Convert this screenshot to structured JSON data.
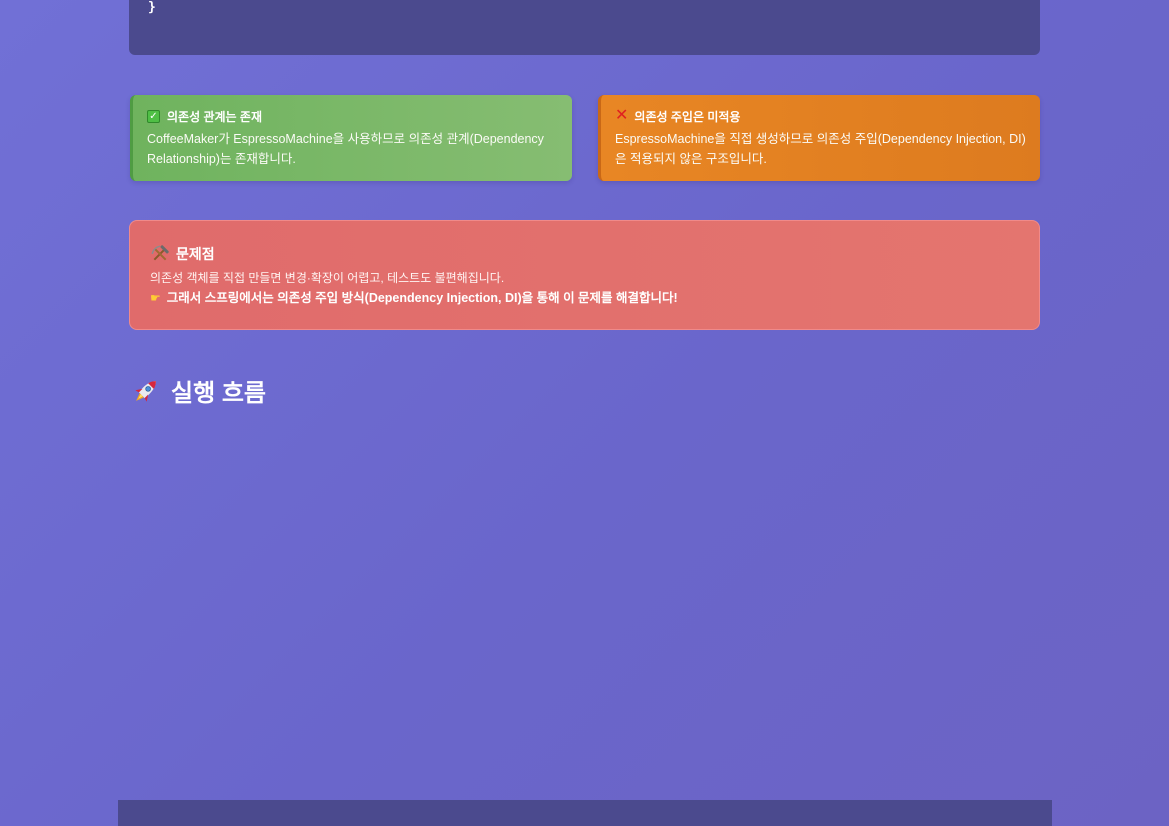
{
  "code": {
    "closing_brace": "}"
  },
  "cards": {
    "dependency": {
      "icon": "check-mark-icon",
      "title": "의존성 관계는 존재",
      "body": "CoffeeMaker가 EspressoMachine을 사용하므로 의존성 관계(Dependency Relationship)는 존재합니다.",
      "color": "#6fb35e"
    },
    "injection": {
      "icon": "cross-mark-icon",
      "title": "의존성 주입은 미적용",
      "body": "EspressoMachine을 직접 생성하므로 의존성 주입(Dependency Injection, DI)은 적용되지 않은 구조입니다.",
      "color": "#e88624"
    }
  },
  "problem": {
    "icon": "hammer-pick-icon",
    "title": "문제점",
    "description": "의존성 객체를 직접 만들면 변경·확장이 어렵고, 테스트도 불편해집니다.",
    "note_icon": "pointing-hand-icon",
    "note": "그래서 스프링에서는 의존성 주입 방식(Dependency Injection, DI)을 통해 이 문제를 해결합니다!",
    "color": "#e06b6b"
  },
  "section": {
    "icon": "rocket-icon",
    "title": "실행 흐름"
  },
  "theme": {
    "background": "#6c6ad0",
    "code_background": "#4b4a8e"
  }
}
